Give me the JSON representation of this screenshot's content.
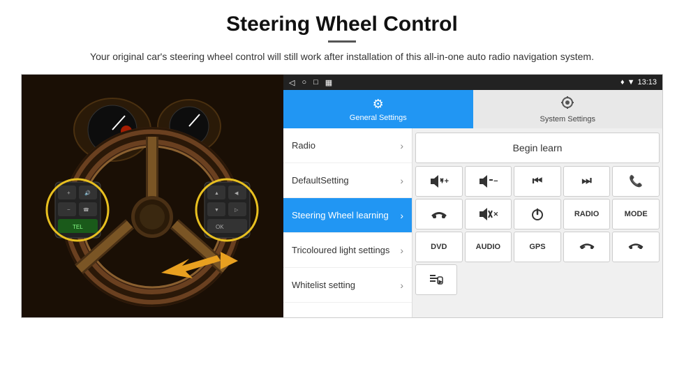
{
  "header": {
    "title": "Steering Wheel Control",
    "divider": true,
    "subtitle": "Your original car's steering wheel control will still work after installation of this all-in-one auto radio navigation system."
  },
  "status_bar": {
    "nav_back": "◁",
    "nav_home": "○",
    "nav_square": "□",
    "nav_cast": "▦",
    "signal_icon": "▼",
    "wifi_icon": "▾",
    "time": "13:13"
  },
  "tabs": [
    {
      "id": "general",
      "label": "General Settings",
      "icon": "⚙",
      "active": true
    },
    {
      "id": "system",
      "label": "System Settings",
      "icon": "⚙",
      "active": false
    }
  ],
  "menu_items": [
    {
      "label": "Radio",
      "active": false
    },
    {
      "label": "DefaultSetting",
      "active": false
    },
    {
      "label": "Steering Wheel learning",
      "active": true
    },
    {
      "label": "Tricoloured light settings",
      "active": false
    },
    {
      "label": "Whitelist setting",
      "active": false
    }
  ],
  "controls": {
    "begin_learn": "Begin learn",
    "row1": [
      "🔊+",
      "🔊−",
      "⏮",
      "⏭",
      "📞"
    ],
    "row1_labels": [
      "vol+",
      "vol-",
      "prev",
      "next",
      "call"
    ],
    "row2_labels": [
      "hangup",
      "mute",
      "power",
      "RADIO",
      "MODE"
    ],
    "row3_labels": [
      "DVD",
      "AUDIO",
      "GPS",
      "ans+prev",
      "ans+next"
    ]
  }
}
